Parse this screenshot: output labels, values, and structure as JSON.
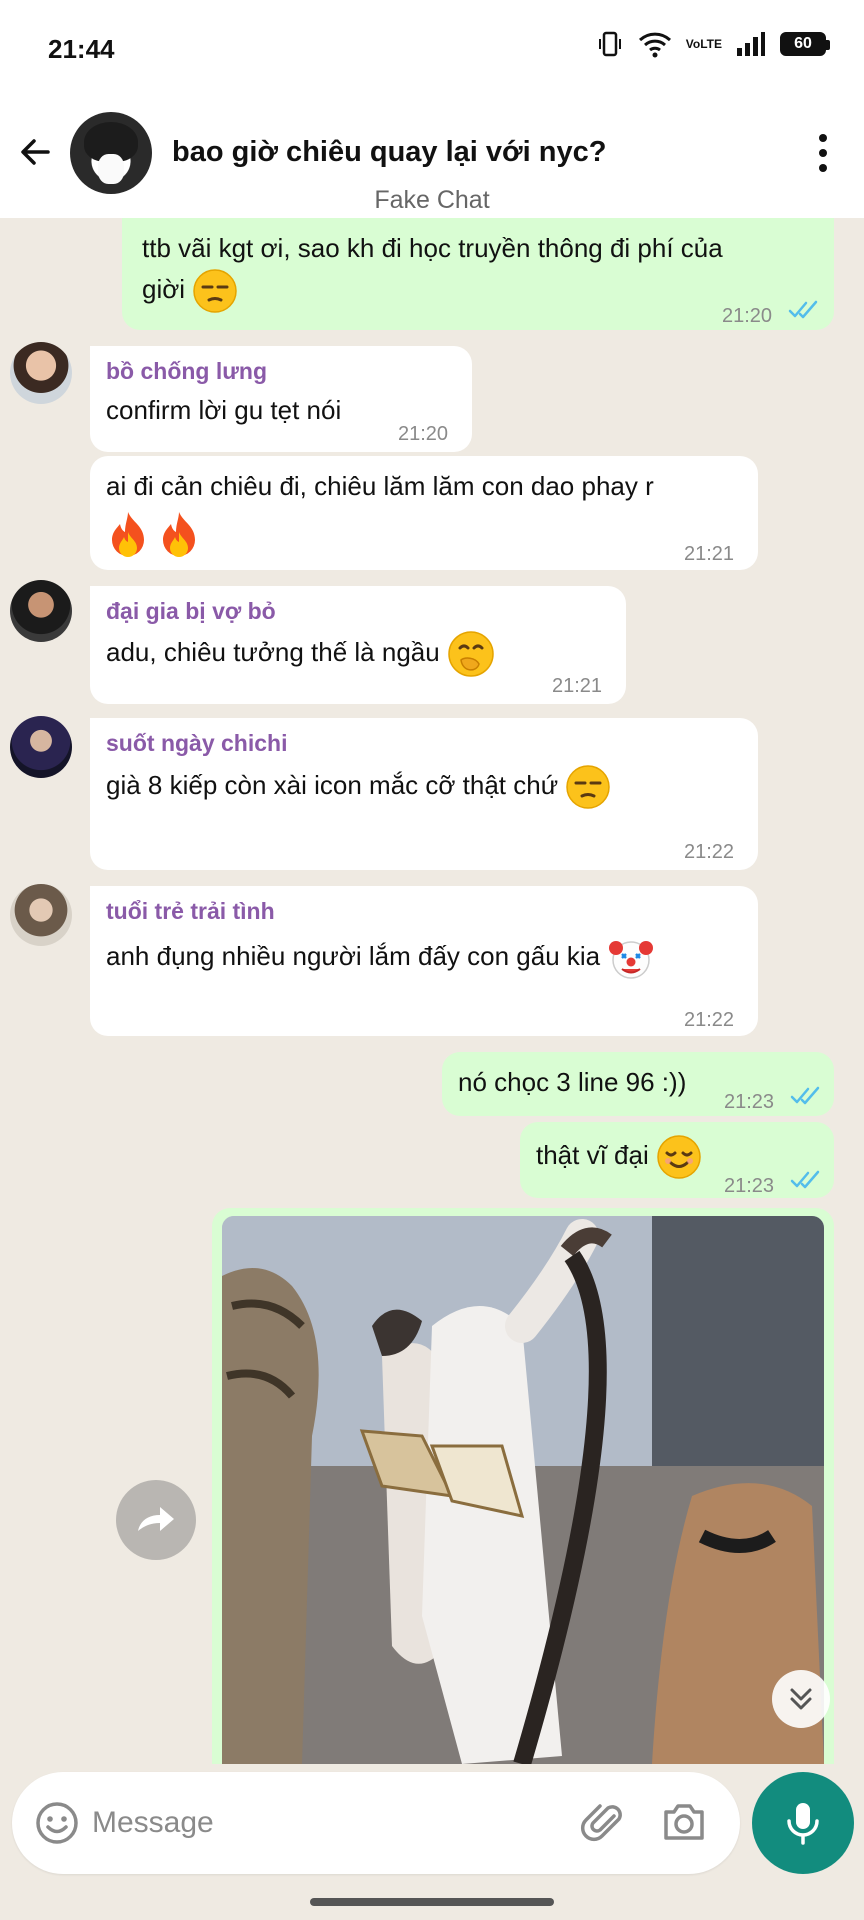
{
  "status_bar": {
    "time": "21:44",
    "battery": "60",
    "volte_top": "Vo",
    "volte_bottom": "LTE"
  },
  "header": {
    "title": "bao giờ chiêu quay lại với nyc?",
    "subtitle": "Fake Chat"
  },
  "messages": [
    {
      "dir": "out",
      "text_line1": "ttb vãi kgt ơi, sao kh đi học truyền thông đi phí của",
      "text_line2": "giời",
      "time": "21:20"
    },
    {
      "dir": "in",
      "sender": "bồ chống lưng",
      "text": "confirm lời gu tẹt nói",
      "time": "21:20"
    },
    {
      "dir": "in",
      "text": "ai đi cản chiêu đi, chiêu lăm lăm con dao phay r",
      "time": "21:21"
    },
    {
      "dir": "in",
      "sender": "đại gia bị vợ bỏ",
      "text": "adu, chiêu tưởng thế là ngầu",
      "time": "21:21"
    },
    {
      "dir": "in",
      "sender": "suốt ngày chichi",
      "text": "già 8 kiếp còn xài icon mắc cỡ thật chứ",
      "time": "21:22"
    },
    {
      "dir": "in",
      "sender": "tuổi trẻ trải tình",
      "text": "anh đụng nhiều người lắm đấy con gấu kia",
      "time": "21:22"
    },
    {
      "dir": "out",
      "text": "nó chọc 3 line 96 :))",
      "time": "21:23"
    },
    {
      "dir": "out",
      "text": "thật vĩ đại",
      "time": "21:23"
    }
  ],
  "icons": {
    "emoji_unamused": "unamused-face-icon",
    "emoji_fire": "fire-icon",
    "emoji_hand_over_mouth": "face-with-hand-over-mouth-icon",
    "emoji_clown": "clown-face-icon",
    "emoji_relieved": "relieved-face-icon"
  },
  "composer": {
    "placeholder": "Message"
  },
  "colors": {
    "outgoing_bubble": "#d9fdd3",
    "incoming_bubble": "#ffffff",
    "chat_background": "#efeae2",
    "sender_name": "#8a5aa8",
    "read_ticks": "#53bdeb",
    "mic_button": "#128c7e"
  }
}
